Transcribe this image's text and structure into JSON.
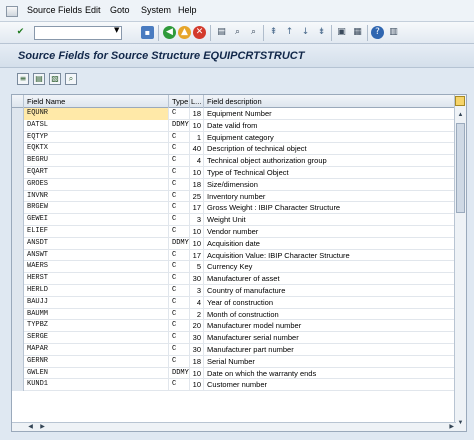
{
  "menu": {
    "items": [
      "Source Fields",
      "Edit",
      "Goto",
      "System",
      "Help"
    ]
  },
  "toolbar": {
    "command_value": "",
    "icons": [
      "check-icon",
      "save-icon",
      "back-icon",
      "exit-icon",
      "cancel-icon",
      "print-icon",
      "find-icon",
      "find-next-icon",
      "first-page-icon",
      "prev-page-icon",
      "next-page-icon",
      "last-page-icon",
      "new-session-icon",
      "shortcut-icon",
      "help-icon",
      "layout-icon"
    ]
  },
  "title": "Source Fields for Source Structure EQUIPCRTSTRUCT",
  "grid": {
    "headers": {
      "name": "Field Name",
      "type": "Type",
      "length": "L...",
      "desc": "Field description"
    },
    "rows": [
      {
        "name": "EQUNR",
        "type": "C",
        "length": "18",
        "desc": "Equipment Number"
      },
      {
        "name": "DATSL",
        "type": "DDMY",
        "length": "10",
        "desc": "Date valid from"
      },
      {
        "name": "EQTYP",
        "type": "C",
        "length": "1",
        "desc": "Equipment category"
      },
      {
        "name": "EQKTX",
        "type": "C",
        "length": "40",
        "desc": "Description of technical object"
      },
      {
        "name": "BEGRU",
        "type": "C",
        "length": "4",
        "desc": "Technical object authorization group"
      },
      {
        "name": "EQART",
        "type": "C",
        "length": "10",
        "desc": "Type of Technical Object"
      },
      {
        "name": "GROES",
        "type": "C",
        "length": "18",
        "desc": "Size/dimension"
      },
      {
        "name": "INVNR",
        "type": "C",
        "length": "25",
        "desc": "Inventory number"
      },
      {
        "name": "BRGEW",
        "type": "C",
        "length": "17",
        "desc": "Gross Weight    : IBIP Character Structure"
      },
      {
        "name": "GEWEI",
        "type": "C",
        "length": "3",
        "desc": "Weight Unit"
      },
      {
        "name": "ELIEF",
        "type": "C",
        "length": "10",
        "desc": "Vendor number"
      },
      {
        "name": "ANSDT",
        "type": "DDMY",
        "length": "10",
        "desc": "Acquisition date"
      },
      {
        "name": "ANSWT",
        "type": "C",
        "length": "17",
        "desc": "Acquisition Value: IBIP Character Structure"
      },
      {
        "name": "WAERS",
        "type": "C",
        "length": "5",
        "desc": "Currency Key"
      },
      {
        "name": "HERST",
        "type": "C",
        "length": "30",
        "desc": "Manufacturer of asset"
      },
      {
        "name": "HERLD",
        "type": "C",
        "length": "3",
        "desc": "Country of manufacture"
      },
      {
        "name": "BAUJJ",
        "type": "C",
        "length": "4",
        "desc": "Year of construction"
      },
      {
        "name": "BAUMM",
        "type": "C",
        "length": "2",
        "desc": "Month of construction"
      },
      {
        "name": "TYPBZ",
        "type": "C",
        "length": "20",
        "desc": "Manufacturer model number"
      },
      {
        "name": "SERGE",
        "type": "C",
        "length": "30",
        "desc": "Manufacturer serial number"
      },
      {
        "name": "MAPAR",
        "type": "C",
        "length": "30",
        "desc": "Manufacturer part number"
      },
      {
        "name": "GERNR",
        "type": "C",
        "length": "18",
        "desc": "Serial Number"
      },
      {
        "name": "GWLEN",
        "type": "DDMY",
        "length": "10",
        "desc": "Date on which the warranty ends"
      },
      {
        "name": "KUND1",
        "type": "C",
        "length": "10",
        "desc": "Customer number"
      }
    ]
  }
}
